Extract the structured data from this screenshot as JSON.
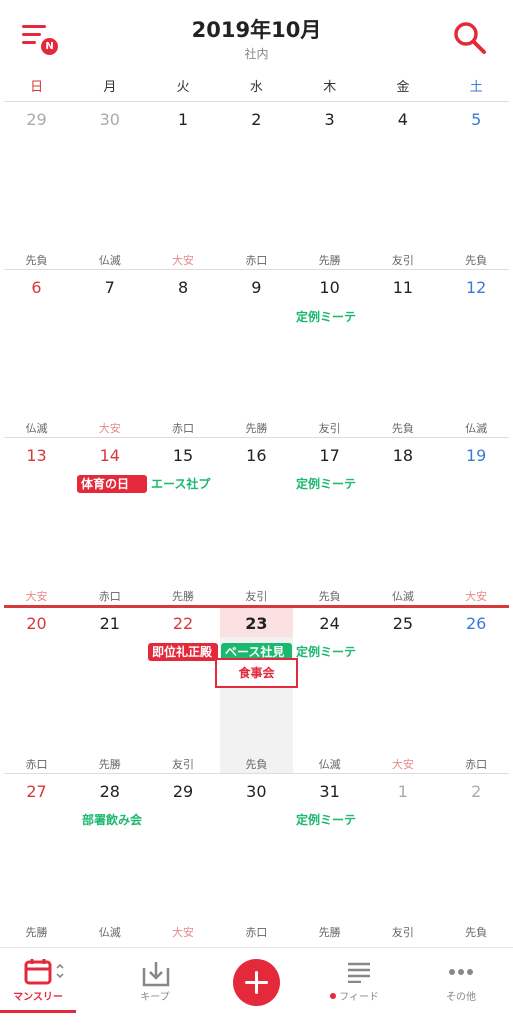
{
  "header": {
    "title": "2019年10月",
    "subtitle": "社内",
    "badge": "N"
  },
  "weekdays": [
    "日",
    "月",
    "火",
    "水",
    "木",
    "金",
    "土"
  ],
  "weeks": [
    {
      "days": [
        "29",
        "30",
        "1",
        "2",
        "3",
        "4",
        "5"
      ],
      "rokuyo": [
        "先負",
        "仏滅",
        "大安",
        "赤口",
        "先勝",
        "友引",
        "先負"
      ]
    },
    {
      "days": [
        "6",
        "7",
        "8",
        "9",
        "10",
        "11",
        "12"
      ],
      "rokuyo": [
        "仏滅",
        "大安",
        "赤口",
        "先勝",
        "友引",
        "先負",
        "仏滅"
      ]
    },
    {
      "days": [
        "13",
        "14",
        "15",
        "16",
        "17",
        "18",
        "19"
      ],
      "rokuyo": [
        "大安",
        "赤口",
        "先勝",
        "友引",
        "先負",
        "仏滅",
        "大安"
      ]
    },
    {
      "days": [
        "20",
        "21",
        "22",
        "23",
        "24",
        "25",
        "26"
      ],
      "rokuyo": [
        "赤口",
        "先勝",
        "友引",
        "先負",
        "仏滅",
        "大安",
        "赤口"
      ]
    },
    {
      "days": [
        "27",
        "28",
        "29",
        "30",
        "31",
        "1",
        "2"
      ],
      "rokuyo": [
        "先勝",
        "仏滅",
        "大安",
        "赤口",
        "先勝",
        "友引",
        "先負"
      ]
    }
  ],
  "events": {
    "w2_thu": "定例ミーテ",
    "w3_sports": "体育の日",
    "w3_ace": "エース社プ",
    "w3_thu": "定例ミーテ",
    "w4_enthrone": "即位礼正殿",
    "w4_base": "ベース社見",
    "w4_thu": "定例ミーテ",
    "w4_dinner": "食事会",
    "w5_drinks": "部署飲み会",
    "w5_thu": "定例ミーテ"
  },
  "tabs": [
    {
      "label": "マンスリー",
      "icon": "calendar-icon"
    },
    {
      "label": "キープ",
      "icon": "keep-download-icon"
    },
    {
      "label": "",
      "icon": "plus-icon"
    },
    {
      "label": "フィード",
      "icon": "feed-lines-icon"
    },
    {
      "label": "その他",
      "icon": "more-dots-icon"
    }
  ],
  "colors": {
    "accent": "#e4293b",
    "green": "#1bb86f",
    "sunday": "#d63a3a",
    "saturday": "#3a7bd5",
    "muted": "#aaaaaa"
  }
}
